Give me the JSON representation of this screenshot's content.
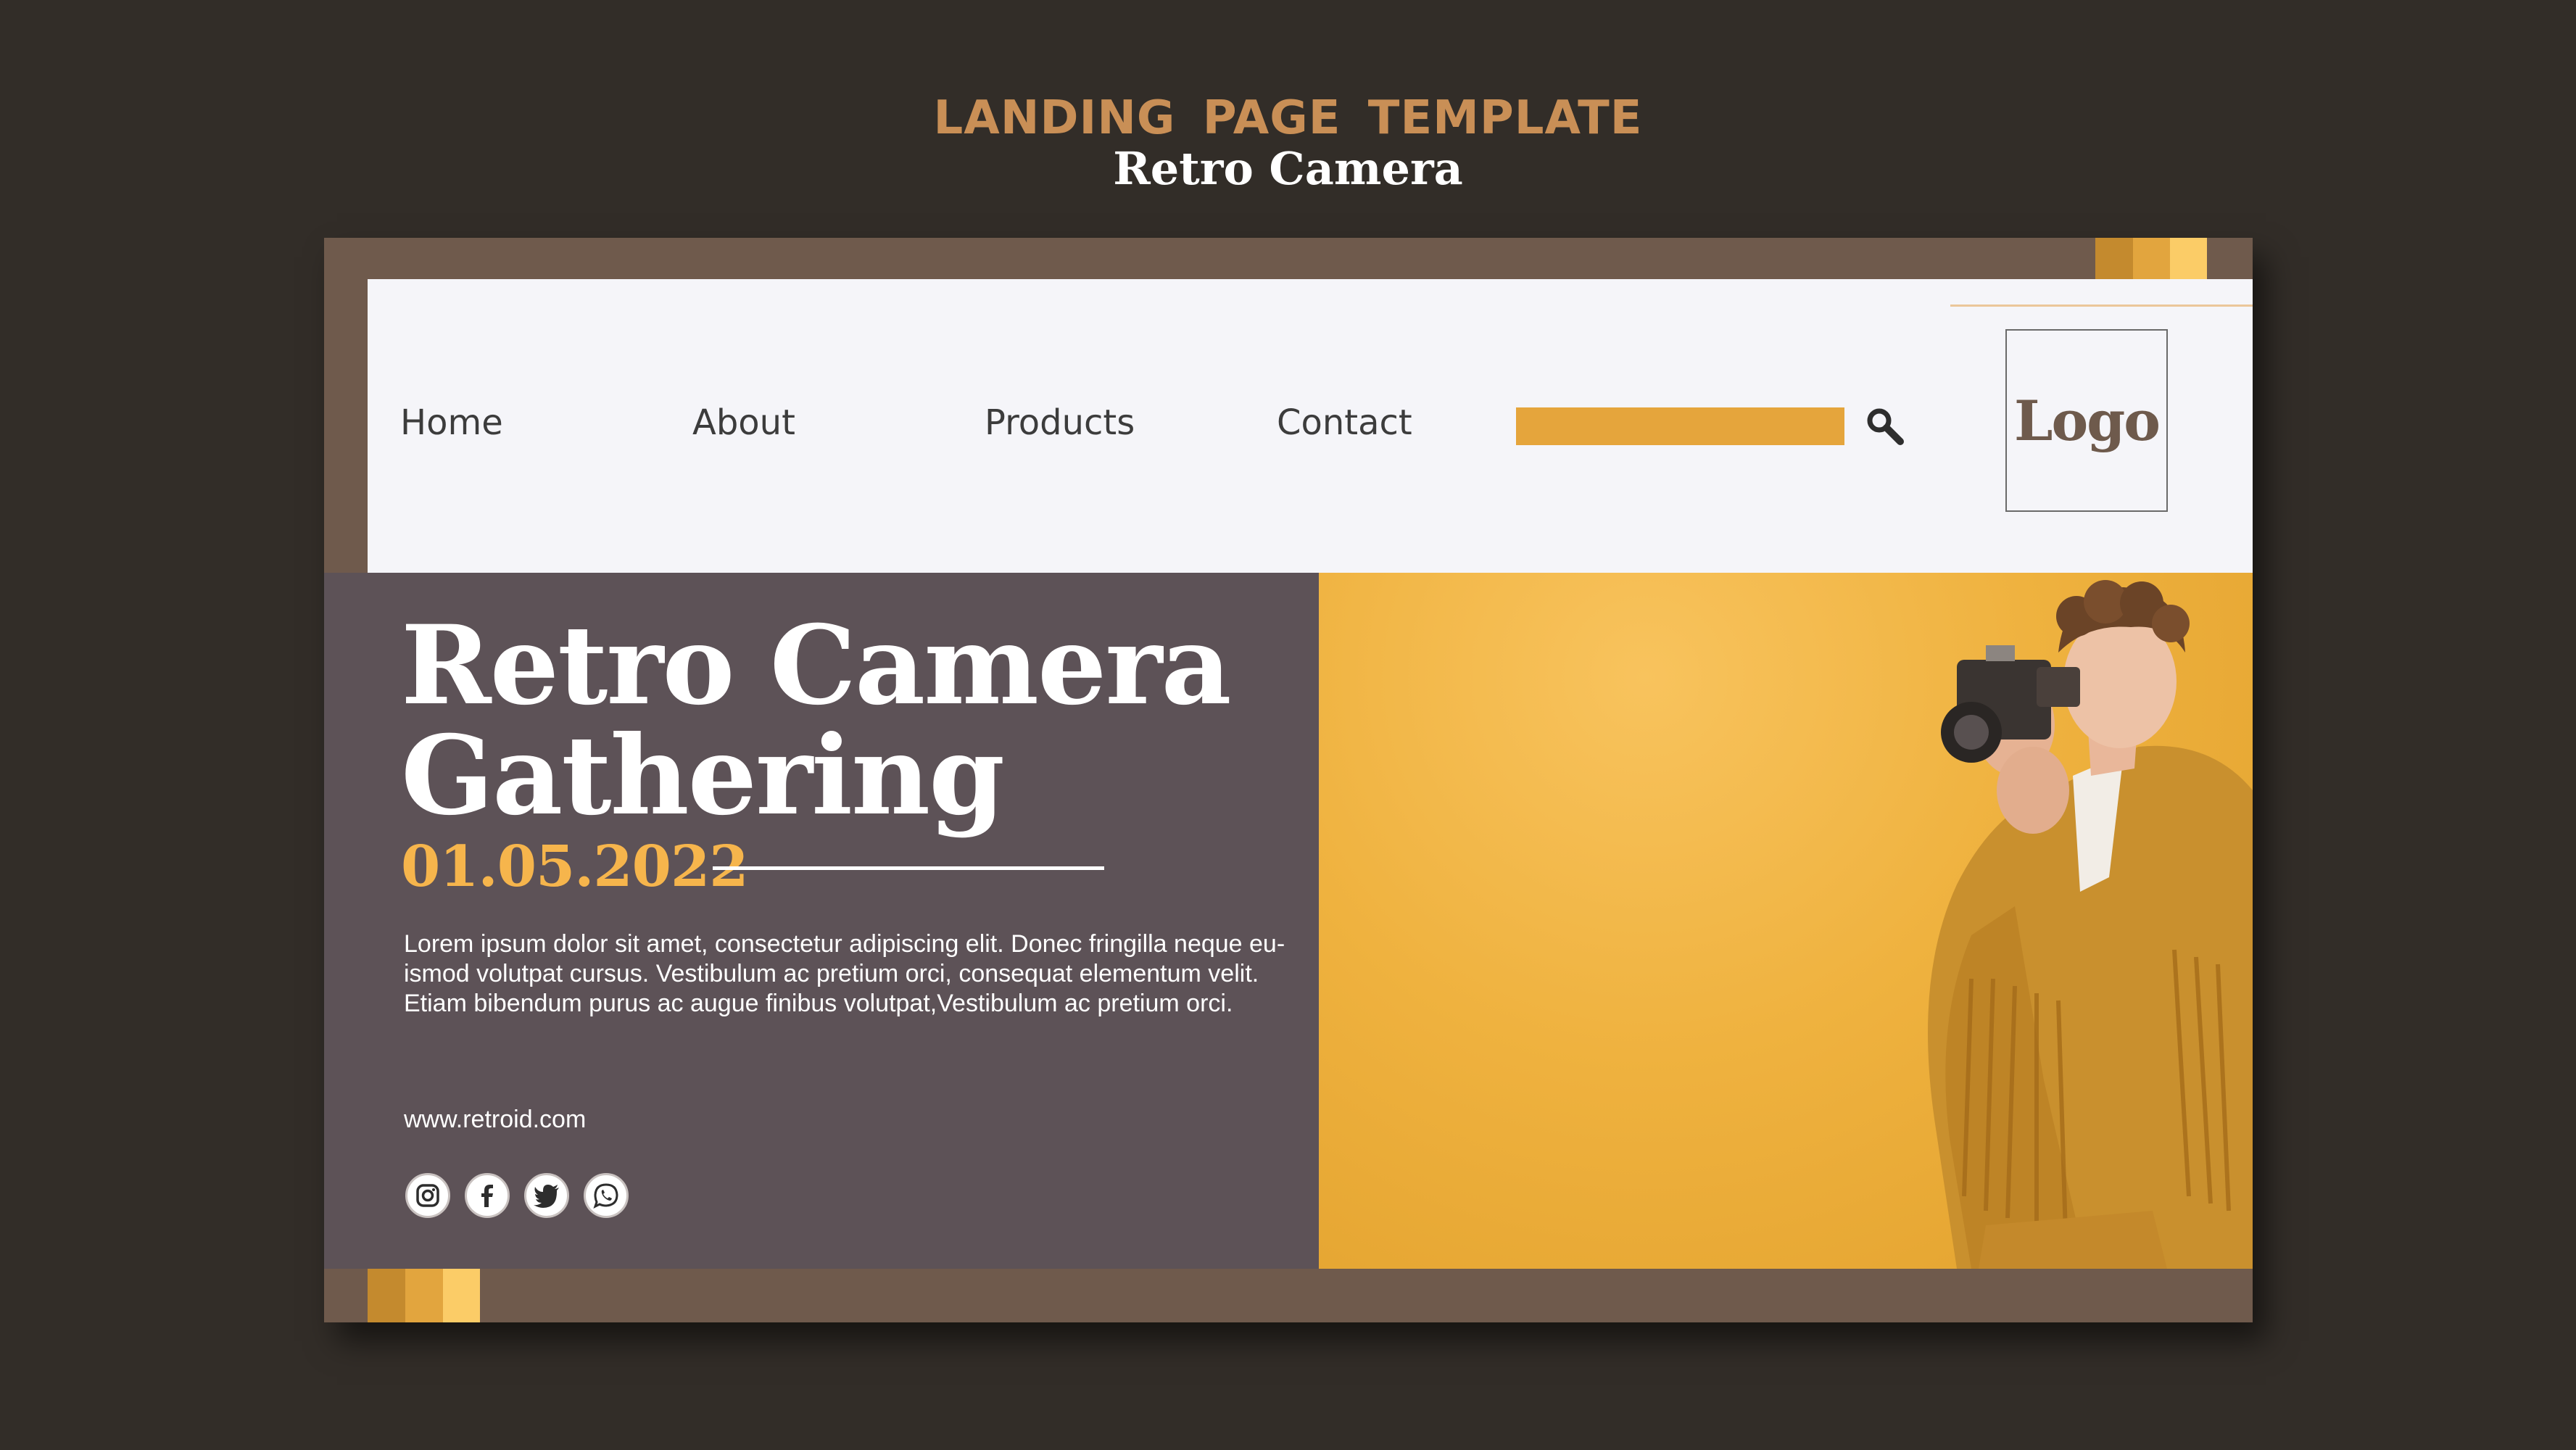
{
  "header": {
    "title": "LANDING  PAGE TEMPLATE",
    "subtitle": "Retro Camera"
  },
  "nav": {
    "items": [
      {
        "label": "Home"
      },
      {
        "label": "About"
      },
      {
        "label": "Products"
      },
      {
        "label": "Contact"
      }
    ],
    "search": {
      "value": "",
      "icon": "search-icon"
    },
    "logo": "Logo"
  },
  "hero": {
    "title_line1": "Retro Camera",
    "title_line2": "Gathering",
    "date": "01.05.2022",
    "body_line1": "Lorem ipsum dolor sit amet, consectetur adipiscing elit. Donec fringilla neque eu-",
    "body_line2": "ismod volutpat cursus. Vestibulum ac pretium orci, consequat elementum velit.",
    "body_line3": "Etiam bibendum purus ac augue finibus volutpat,Vestibulum ac pretium orci.",
    "url": "www.retroid.com",
    "social": [
      "instagram-icon",
      "facebook-icon",
      "twitter-icon",
      "whatsapp-icon"
    ],
    "image": "photo of a young man in a yellow fringed jacket holding a vintage camera"
  },
  "colors": {
    "background": "#322d28",
    "frame": "#6f5a4c",
    "nav_panel": "#f5f5f9",
    "accent": "#e5a53c",
    "accent_text": "#f6b54c",
    "hero_left": "#5d5257",
    "hero_right": "#efb23f",
    "title_brown": "#c98f56",
    "swatches": [
      "#c48a2e",
      "#e2a53e",
      "#fbcc67"
    ]
  }
}
